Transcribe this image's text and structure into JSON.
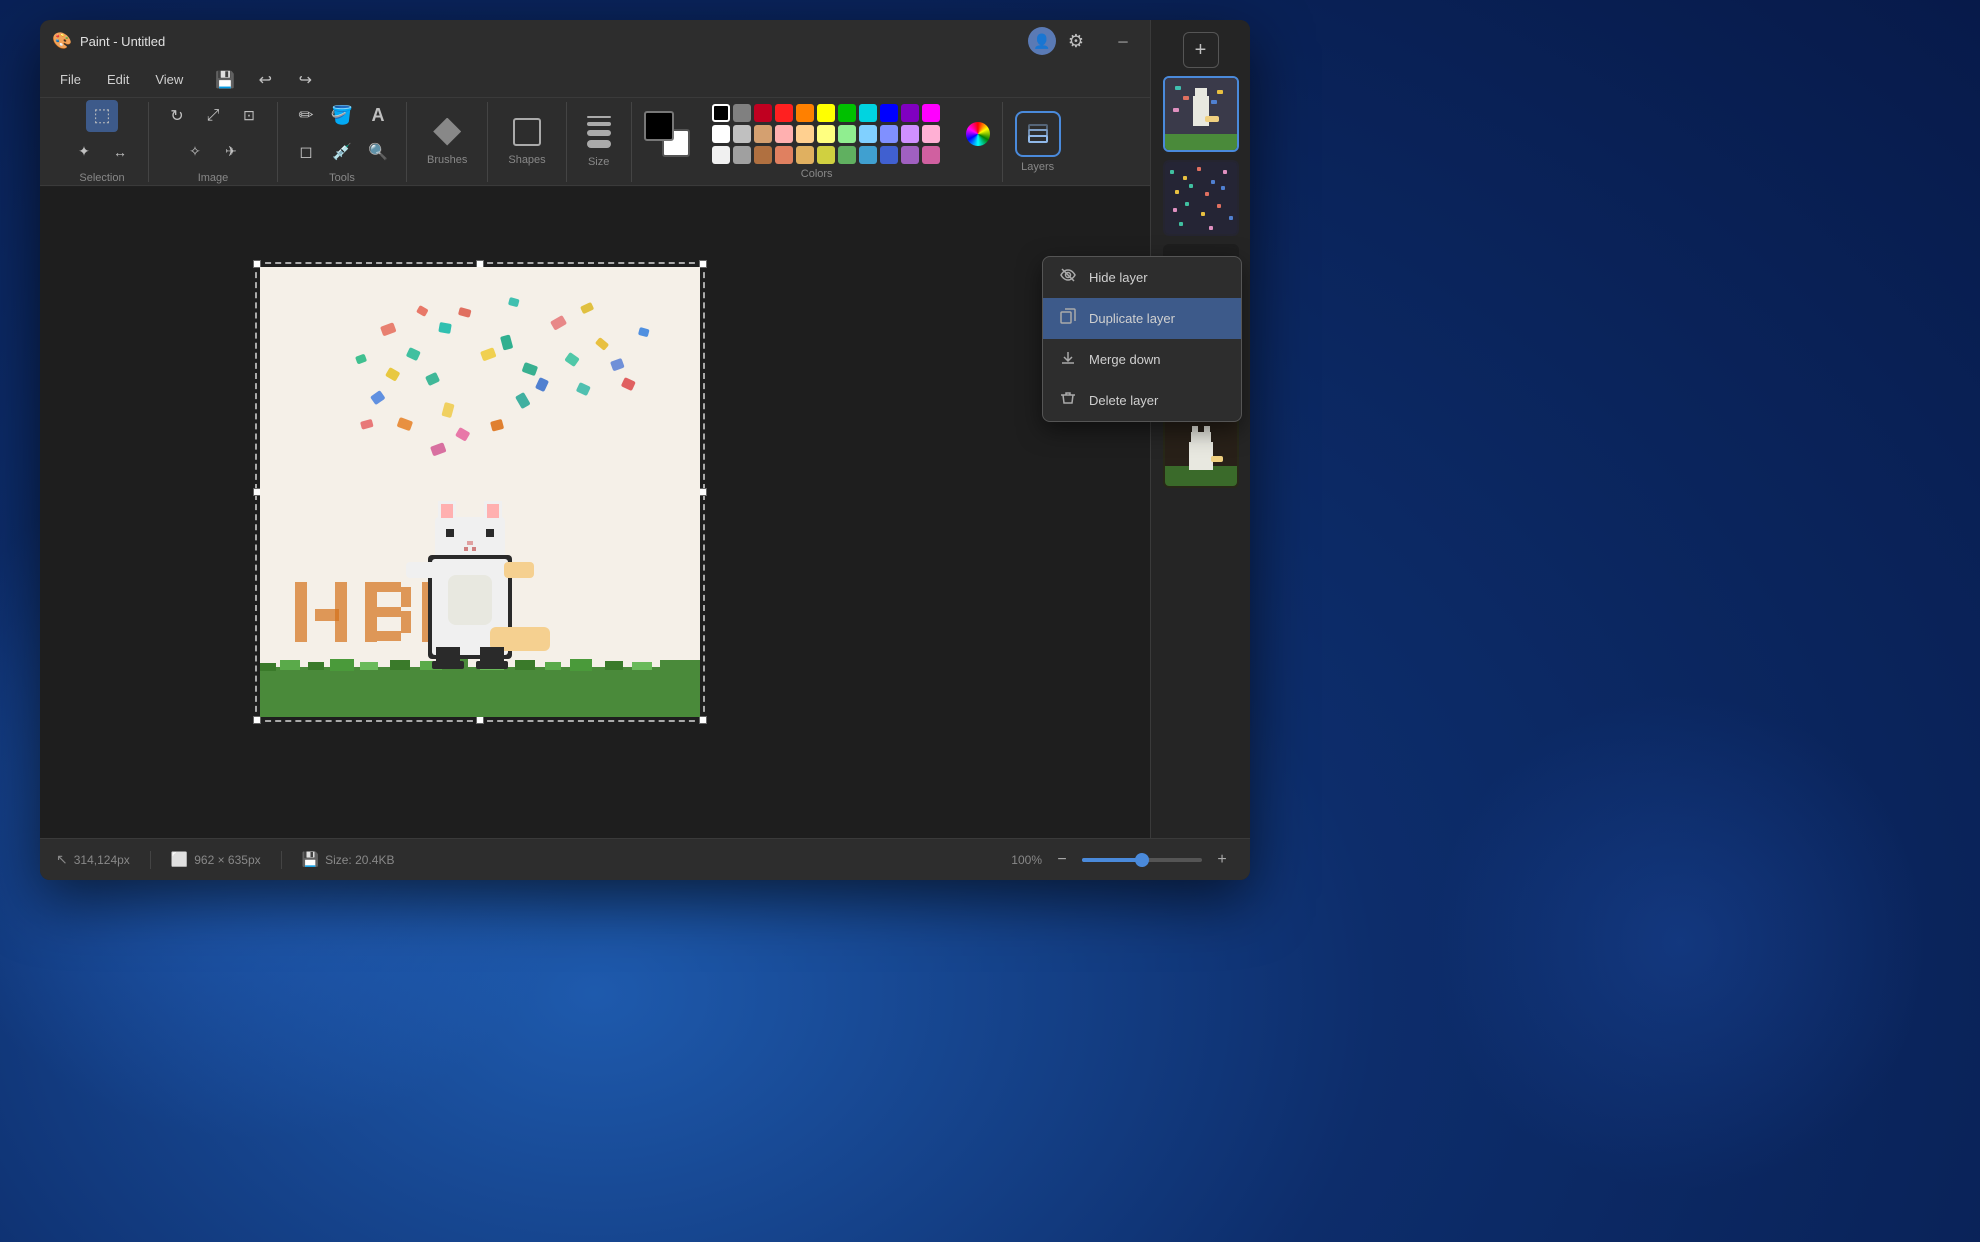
{
  "window": {
    "title": "Paint - Untitled",
    "titlebar_icon": "🎨"
  },
  "menubar": {
    "items": [
      "File",
      "Edit",
      "View"
    ]
  },
  "toolbar": {
    "groups": {
      "selection": {
        "label": "Selection",
        "tools": [
          "select-rect",
          "select-free",
          "transform",
          "invert"
        ]
      },
      "image": {
        "label": "Image",
        "tools": [
          "rotate",
          "resize",
          "crop"
        ]
      },
      "tools": {
        "label": "Tools",
        "tools": [
          "pencil",
          "fill",
          "text",
          "eraser",
          "color-pick",
          "magnify"
        ]
      },
      "brushes": {
        "label": "Brushes"
      },
      "shapes": {
        "label": "Shapes"
      },
      "size": {
        "label": "Size"
      },
      "colors": {
        "label": "Colors"
      },
      "layers": {
        "label": "Layers"
      }
    }
  },
  "colors": {
    "primary": "#000000",
    "secondary": "#ffffff",
    "palette_row1": [
      "#000000",
      "#808080",
      "#c00000",
      "#ff0000",
      "#ff8000",
      "#ffff00",
      "#00c000",
      "#00ffff",
      "#0000ff",
      "#8000ff",
      "#ff00ff"
    ],
    "palette_row2": [
      "#ffffff",
      "#c0c0c0",
      "#d4a070",
      "#ffb0b0",
      "#ffd0a0",
      "#ffff80",
      "#90ee90",
      "#80d0ff",
      "#8080ff",
      "#d0a0ff",
      "#ffb0ff",
      "#e0b0d0"
    ],
    "palette_row3": [
      "#f0f0f0",
      "#a0a0a0",
      "#b07040",
      "#e08060",
      "#e0b060",
      "#d0d040",
      "#60b060",
      "#40a0d0",
      "#4060d0",
      "#a060c0",
      "#d060a0",
      "#c07080"
    ]
  },
  "statusbar": {
    "cursor_pos": "314,124px",
    "canvas_size": "962 × 635px",
    "file_size": "Size: 20.4KB",
    "zoom": "100%"
  },
  "layers": {
    "add_btn": "+",
    "items": [
      {
        "id": 1,
        "active": true,
        "type": "confetti-character"
      },
      {
        "id": 2,
        "active": false,
        "type": "bg-pattern"
      },
      {
        "id": 3,
        "active": false,
        "type": "hbd-text"
      },
      {
        "id": 4,
        "active": false,
        "type": "yellow-bg"
      },
      {
        "id": 5,
        "active": false,
        "type": "character-ground"
      }
    ]
  },
  "context_menu": {
    "items": [
      {
        "id": "hide",
        "label": "Hide layer",
        "icon": "👁"
      },
      {
        "id": "duplicate",
        "label": "Duplicate layer",
        "icon": "⧉",
        "highlighted": true
      },
      {
        "id": "merge",
        "label": "Merge down",
        "icon": "⬇"
      },
      {
        "id": "delete",
        "label": "Delete layer",
        "icon": "🗑"
      }
    ]
  },
  "icons": {
    "minimize": "─",
    "maximize": "□",
    "close": "✕",
    "pencil": "✏",
    "fill": "◈",
    "text": "A",
    "eraser": "◫",
    "select": "⬚",
    "magnify": "⊕",
    "layers": "⊞",
    "user": "👤",
    "settings": "⚙",
    "undo": "↩",
    "redo": "↪",
    "save": "💾",
    "cursor": "⬆"
  }
}
